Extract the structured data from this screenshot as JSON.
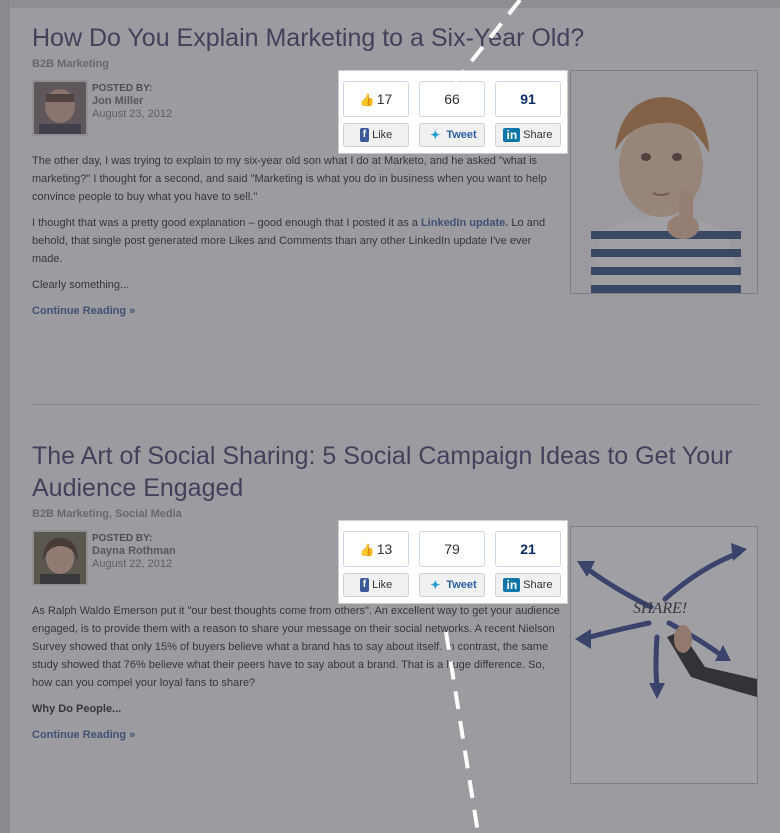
{
  "posts": [
    {
      "title": "How Do You Explain Marketing to a Six-Year Old?",
      "category": "B2B Marketing",
      "posted_by_label": "POSTED BY:",
      "author": "Jon Miller",
      "date": "August 23, 2012",
      "share": {
        "like_count": "17",
        "tweet_count": "66",
        "share_count": "91",
        "like_label": "Like",
        "tweet_label": "Tweet",
        "share_label": "Share"
      },
      "paragraphs": [
        "The other day, I was trying to explain to my six-year old son what I do at Marketo, and he asked \"what is marketing?\" I thought for a second, and said \"Marketing is what you do in business when you want to help convince people to buy what you have to sell.\"",
        "I thought that was a pretty good explanation – good enough that I posted it as a ",
        "Lo and behold, that single post generated more Likes and Comments than any other LinkedIn update I've ever made.",
        "Clearly something..."
      ],
      "link_text": "LinkedIn update.",
      "continue_label": "Continue Reading »",
      "image_icon": "thinking-boy-photo"
    },
    {
      "title": "The Art of Social Sharing: 5 Social Campaign Ideas to Get Your Audience Engaged",
      "category": "B2B Marketing, Social Media",
      "posted_by_label": "POSTED BY:",
      "author": "Dayna Rothman",
      "date": "August 22, 2012",
      "share": {
        "like_count": "13",
        "tweet_count": "79",
        "share_count": "21",
        "like_label": "Like",
        "tweet_label": "Tweet",
        "share_label": "Share"
      },
      "paragraphs": [
        "As Ralph Waldo Emerson put it \"our best thoughts come from others\". An excellent way to get your audience engaged, is to provide them with a reason to share your message on their social networks.  A recent Nielson Survey showed that only 15% of buyers believe what a brand has to say about itself. In contrast, the same study showed that 76% believe what their peers have to say about a brand. That is a huge difference. So, how can you compel your loyal fans to share?",
        "Why Do People..."
      ],
      "continue_label": "Continue Reading »",
      "image_icon": "share-arrows-sketch"
    }
  ]
}
